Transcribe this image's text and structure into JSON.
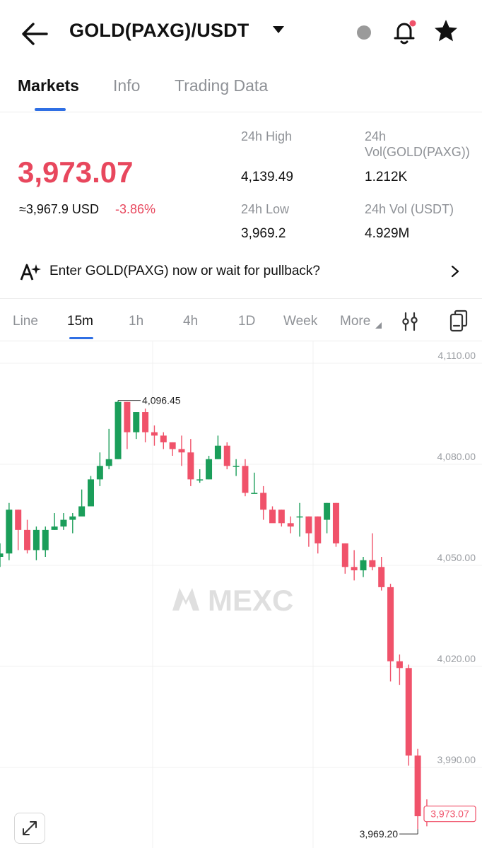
{
  "header": {
    "title": "GOLD(PAXG)/USDT",
    "icons": [
      "back-arrow-icon",
      "caret-down-icon",
      "bell-icon",
      "star-icon"
    ]
  },
  "tabs": [
    "Markets",
    "Info",
    "Trading Data"
  ],
  "ticker": {
    "price": "3,973.07",
    "usd_equiv": "≈3,967.9 USD",
    "change": "-3.86%",
    "high_label": "24h High",
    "high_value": "4,139.49",
    "vol_base_label_1": "24h",
    "vol_base_label_2": "Vol(GOLD(PAXG))",
    "vol_base_value": "1.212K",
    "low_label": "24h Low",
    "low_value": "3,969.2",
    "vol_quote_label": "24h Vol (USDT)",
    "vol_quote_value": "4.929M"
  },
  "banner": {
    "text": "Enter GOLD(PAXG) now or wait for pullback?"
  },
  "intervals": [
    "Line",
    "15m",
    "1h",
    "4h",
    "1D",
    "Week",
    "More"
  ],
  "colors": {
    "up": "#1b9e5a",
    "down": "#f0526a",
    "accent": "#2f6fe4",
    "muted": "#8e9196"
  },
  "chart_data": {
    "type": "candlestick",
    "watermark": "MEXC",
    "y_ticks": [
      "4,110.00",
      "4,080.00",
      "4,050.00",
      "4,020.00",
      "3,990.00"
    ],
    "y_tick_values": [
      4110,
      4080,
      4050,
      4020,
      3990
    ],
    "high_marker": "4,096.45",
    "high_marker_value": 4096.45,
    "low_marker": "3,969.20",
    "low_marker_value": 3969.2,
    "last_price": "3,973.07",
    "last_price_value": 3973.07,
    "candles": [
      [
        4050,
        4051,
        4054,
        4047
      ],
      [
        4051,
        4064,
        4066,
        4049
      ],
      [
        4064,
        4058,
        4064,
        4052
      ],
      [
        4058,
        4052,
        4061,
        4051
      ],
      [
        4052,
        4058,
        4059,
        4049
      ],
      [
        4052,
        4058,
        4059,
        4050
      ],
      [
        4058,
        4059,
        4063,
        4058
      ],
      [
        4059,
        4061,
        4063,
        4058
      ],
      [
        4061,
        4062,
        4063,
        4057
      ],
      [
        4062,
        4065,
        4070,
        4063
      ],
      [
        4065,
        4073,
        4074,
        4065
      ],
      [
        4073,
        4077,
        4081,
        4071
      ],
      [
        4077,
        4079,
        4088,
        4076
      ],
      [
        4079,
        4096,
        4096.45,
        4079
      ],
      [
        4096,
        4087,
        4096,
        4082
      ],
      [
        4087,
        4093,
        4093,
        4085
      ],
      [
        4093,
        4087,
        4094,
        4084
      ],
      [
        4087,
        4086,
        4089,
        4083
      ],
      [
        4086,
        4084,
        4087,
        4082
      ],
      [
        4084,
        4082,
        4084,
        4080
      ],
      [
        4082,
        4081,
        4086,
        4077
      ],
      [
        4081,
        4073,
        4085,
        4071
      ],
      [
        4073,
        4073,
        4076,
        4072
      ],
      [
        4073,
        4079,
        4080,
        4073
      ],
      [
        4079,
        4083,
        4086,
        4079
      ],
      [
        4083,
        4077,
        4084,
        4076
      ],
      [
        4077,
        4077,
        4079,
        4074
      ],
      [
        4077,
        4069,
        4079,
        4068
      ],
      [
        4069,
        4069,
        4075,
        4069
      ],
      [
        4069,
        4064,
        4071,
        4061
      ],
      [
        4064,
        4060,
        4065,
        4061
      ],
      [
        4064,
        4060,
        4064,
        4059
      ],
      [
        4060,
        4059,
        4062,
        4057
      ],
      [
        4062,
        4062,
        4066,
        4056
      ],
      [
        4062,
        4057,
        4062,
        4053
      ],
      [
        4062,
        4054,
        4062,
        4051
      ],
      [
        4061,
        4066,
        4066,
        4057
      ],
      [
        4066,
        4054,
        4066,
        4053
      ],
      [
        4054,
        4047,
        4054,
        4045
      ],
      [
        4047,
        4046,
        4052,
        4043
      ],
      [
        4046,
        4049,
        4050,
        4044
      ],
      [
        4049,
        4047,
        4057,
        4046
      ],
      [
        4047,
        4041,
        4050,
        4040
      ],
      [
        4041,
        4019,
        4042,
        4013
      ],
      [
        4019,
        4017,
        4021,
        4012
      ],
      [
        4017,
        3991,
        4018,
        3988
      ],
      [
        3991,
        3973,
        3993,
        3969.2
      ],
      [
        3975,
        3972,
        3978,
        3970
      ]
    ]
  }
}
